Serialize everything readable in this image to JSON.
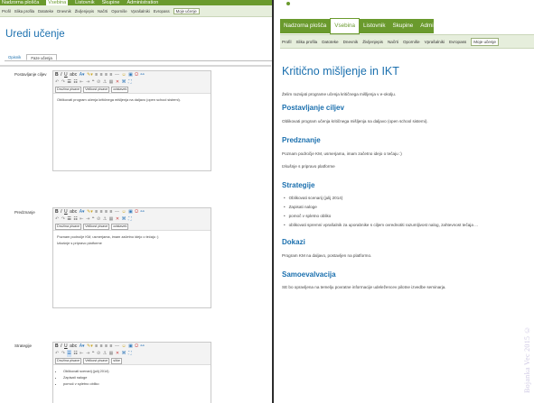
{
  "left": {
    "topnav": [
      {
        "label": "Nadzorna plošča",
        "active": false
      },
      {
        "label": "Vsebina",
        "active": true
      },
      {
        "label": "Listovnik",
        "active": false
      },
      {
        "label": "Skupine",
        "active": false
      },
      {
        "label": "Administration",
        "active": false
      }
    ],
    "subnav": [
      "Profil",
      "Slika profila",
      "Datoteke",
      "Dnevnik",
      "Življenjepis",
      "Načrti",
      "Oporniše",
      "Vprašalniki",
      "Evropass",
      "Moje učenje"
    ],
    "subnav_active": "Moje učenje",
    "title": "Uredi učenje",
    "tabs": [
      {
        "label": "Opisnik",
        "active": false
      },
      {
        "label": "Faze učenja",
        "active": true
      }
    ],
    "fields": [
      {
        "label": "Postavljanje ciljev",
        "format": "Družina pisave",
        "size": "Velikost pisave",
        "extra": "odstavek",
        "lines": [
          "Oblikovati program učenja kritičnega mišljenja na daljavo (open school sistemi)."
        ]
      },
      {
        "label": "Predznanje",
        "format": "Družina pisave",
        "size": "Velikost pisave",
        "extra": "odstavek",
        "lines": [
          "Poznam področje KM, usmerjama, imam začetno idejo o tečaju :)",
          "Izkušnje s pripravo platforme"
        ]
      },
      {
        "label": "Strategije",
        "format": "Družina pisave",
        "size": "Velikost pisave",
        "extra": "slike",
        "bullets": [
          "Oblikovati scenarij (julij 2014)",
          "Zapisati naloge",
          "pomoč v spletno obliko"
        ]
      }
    ]
  },
  "right": {
    "topnav": [
      {
        "label": "Nadzorna plošča",
        "active": false
      },
      {
        "label": "Vsebina",
        "active": true
      },
      {
        "label": "Listovnik",
        "active": false
      },
      {
        "label": "Skupine",
        "active": false
      },
      {
        "label": "Administration",
        "active": false
      }
    ],
    "subnav": [
      "Profil",
      "Slika profila",
      "Datoteke",
      "Dnevnik",
      "Življenjepis",
      "Načrti",
      "Oporniše",
      "Vprašalniki",
      "Evropass",
      "Moje učenje"
    ],
    "subnav_active": "Moje učenje",
    "title": "Kritično mišljenje in IKT",
    "intro": "Želim razvijati programe učenja kritičnega mišljenja v e-okolju.",
    "sections": {
      "goals": {
        "heading": "Postavljanje ciljev",
        "text": "Oblikovati program učenja kritičnega mišljenja na daljavo (open school sistemi)."
      },
      "prior": {
        "heading": "Predznanje",
        "text1": "Poznam področje KM, usmerjama, imam začetno idejo o tečaju :)",
        "text2": "Izkušnje s pripravo platforme"
      },
      "strategies": {
        "heading": "Strategije",
        "items": [
          "Oblikovati scenarij (julij 2014)",
          "Zapisati naloge",
          "pomoč v spletno obliko",
          "oblikovati spremni vprašalnik za uporabnike s ciljem ovrednotiti razumljivost nalog, zahtevnost tečaja ..."
        ]
      },
      "evidence": {
        "heading": "Dokazi",
        "text": "Program KM na daljavo, postavljen na platformo."
      },
      "self": {
        "heading": "Samoevalvacija",
        "text": "SE bo opravljena na temelju povratne informacije udeležencev pilotne izvedbe seminarja."
      }
    },
    "watermark": "Bojanka Vec 2015 ©"
  },
  "colors": {
    "accent_green": "#6a9a2d",
    "link_blue": "#1a6fae"
  }
}
